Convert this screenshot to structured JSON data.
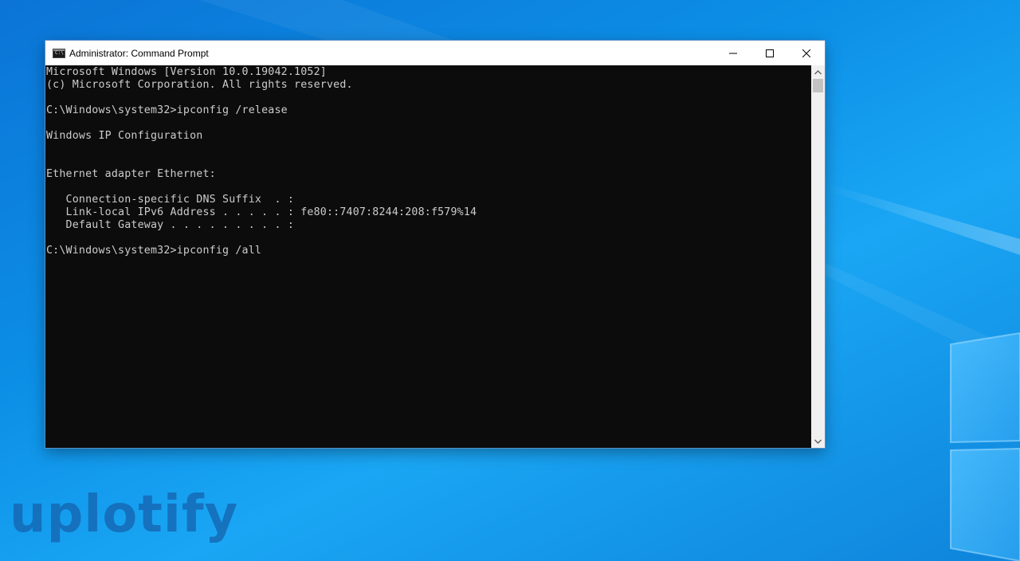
{
  "desktop": {
    "background_color": "#0c8fe6",
    "watermark": "uplotify"
  },
  "window": {
    "title": "Administrator: Command Prompt",
    "app_icon_text": "C:\\",
    "buttons": {
      "minimize_icon": "minimize-icon",
      "maximize_icon": "maximize-icon",
      "close_icon": "close-icon"
    }
  },
  "terminal": {
    "background": "#0c0c0c",
    "foreground": "#cccccc",
    "lines": [
      "Microsoft Windows [Version 10.0.19042.1052]",
      "(c) Microsoft Corporation. All rights reserved.",
      "",
      "C:\\Windows\\system32>ipconfig /release",
      "",
      "Windows IP Configuration",
      "",
      "",
      "Ethernet adapter Ethernet:",
      "",
      "   Connection-specific DNS Suffix  . :",
      "   Link-local IPv6 Address . . . . . : fe80::7407:8244:208:f579%14",
      "   Default Gateway . . . . . . . . . :",
      "",
      "C:\\Windows\\system32>ipconfig /all"
    ]
  }
}
